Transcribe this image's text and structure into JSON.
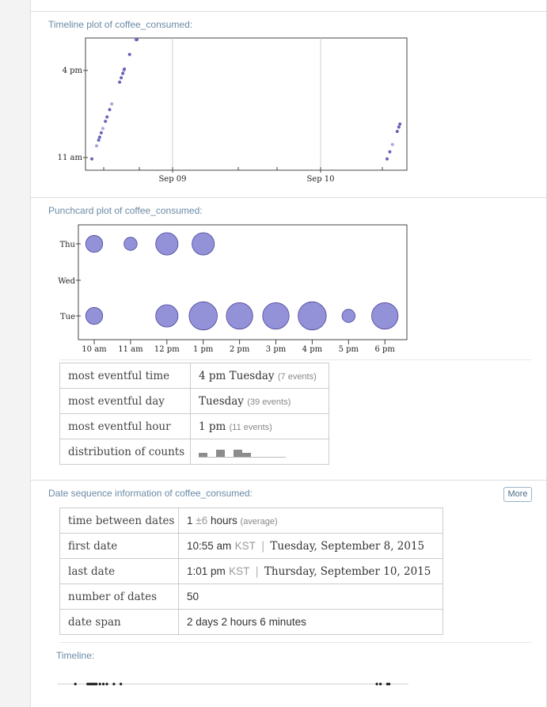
{
  "timeline_section": {
    "title": "Timeline plot of coffee_consumed:",
    "chart_data": {
      "type": "scatter",
      "x_ticks": [
        "Sep 09",
        "Sep 10"
      ],
      "y_ticks": [
        "4 pm",
        "11 am"
      ],
      "points": [
        {
          "day": 8,
          "time": "10:55"
        },
        {
          "day": 8,
          "time": "11:40"
        },
        {
          "day": 8,
          "time": "12:00"
        },
        {
          "day": 8,
          "time": "12:10"
        },
        {
          "day": 8,
          "time": "12:25"
        },
        {
          "day": 8,
          "time": "12:40"
        },
        {
          "day": 8,
          "time": "13:05"
        },
        {
          "day": 8,
          "time": "13:20"
        },
        {
          "day": 8,
          "time": "13:45"
        },
        {
          "day": 8,
          "time": "14:05"
        },
        {
          "day": 8,
          "time": "15:20"
        },
        {
          "day": 8,
          "time": "15:35"
        },
        {
          "day": 8,
          "time": "15:50"
        },
        {
          "day": 8,
          "time": "16:00"
        },
        {
          "day": 8,
          "time": "16:05"
        },
        {
          "day": 8,
          "time": "16:55"
        },
        {
          "day": 8,
          "time": "17:55"
        },
        {
          "day": 8,
          "time": "18:00"
        },
        {
          "day": 8,
          "time": "18:05"
        },
        {
          "day": 10,
          "time": "10:55"
        },
        {
          "day": 10,
          "time": "11:20"
        },
        {
          "day": 10,
          "time": "11:45"
        },
        {
          "day": 10,
          "time": "12:30"
        },
        {
          "day": 10,
          "time": "12:45"
        },
        {
          "day": 10,
          "time": "12:55"
        }
      ]
    }
  },
  "punchcard_section": {
    "title": "Punchcard plot of coffee_consumed:",
    "chart_data": {
      "type": "scatter",
      "x_ticks": [
        "10 am",
        "11 am",
        "12 pm",
        "1 pm",
        "2 pm",
        "3 pm",
        "4 pm",
        "5 pm",
        "6 pm"
      ],
      "y_ticks": [
        "Thu",
        "Wed",
        "Tue"
      ],
      "bubbles": [
        {
          "day": "Thu",
          "hour": "10 am",
          "count": 2
        },
        {
          "day": "Thu",
          "hour": "11 am",
          "count": 1
        },
        {
          "day": "Thu",
          "hour": "12 pm",
          "count": 4
        },
        {
          "day": "Thu",
          "hour": "1 pm",
          "count": 4
        },
        {
          "day": "Tue",
          "hour": "10 am",
          "count": 2
        },
        {
          "day": "Tue",
          "hour": "12 pm",
          "count": 4
        },
        {
          "day": "Tue",
          "hour": "1 pm",
          "count": 7
        },
        {
          "day": "Tue",
          "hour": "2 pm",
          "count": 6
        },
        {
          "day": "Tue",
          "hour": "3 pm",
          "count": 6
        },
        {
          "day": "Tue",
          "hour": "4 pm",
          "count": 7
        },
        {
          "day": "Tue",
          "hour": "5 pm",
          "count": 1
        },
        {
          "day": "Tue",
          "hour": "6 pm",
          "count": 6
        }
      ]
    },
    "stats": {
      "rows": [
        {
          "label": "most eventful time",
          "value": "4 pm Tuesday",
          "note": "(7 events)"
        },
        {
          "label": "most eventful day",
          "value": "Tuesday",
          "note": "(39 events)"
        },
        {
          "label": "most eventful hour",
          "value": "1 pm",
          "note": "(11 events)"
        },
        {
          "label": "distribution of counts",
          "value": "",
          "note": ""
        }
      ],
      "distribution": [
        1,
        0,
        2,
        0,
        2,
        1,
        0,
        0,
        0,
        0
      ]
    }
  },
  "date_section": {
    "title": "Date sequence information of coffee_consumed:",
    "more_label": "More",
    "rows": {
      "time_between": {
        "label": "time between dates",
        "mean": "1",
        "pm": "±",
        "sd": "6",
        "unit": "hours",
        "note": "(average)"
      },
      "first_date": {
        "label": "first date",
        "time": "10:55 am",
        "tz": "KST",
        "sep": "|",
        "date": "Tuesday, September 8, 2015"
      },
      "last_date": {
        "label": "last date",
        "time": "1:01 pm",
        "tz": "KST",
        "sep": "|",
        "date": "Thursday, September 10, 2015"
      },
      "number_of_dates": {
        "label": "number of dates",
        "value": "50"
      },
      "date_span": {
        "label": "date span",
        "value": "2 days 2 hours 6 minutes"
      }
    },
    "timeline_label": "Timeline:",
    "timeline_marks": [
      0.05,
      0.085,
      0.09,
      0.095,
      0.1,
      0.105,
      0.11,
      0.12,
      0.13,
      0.14,
      0.16,
      0.18,
      0.91,
      0.92,
      0.94,
      0.945
    ]
  }
}
